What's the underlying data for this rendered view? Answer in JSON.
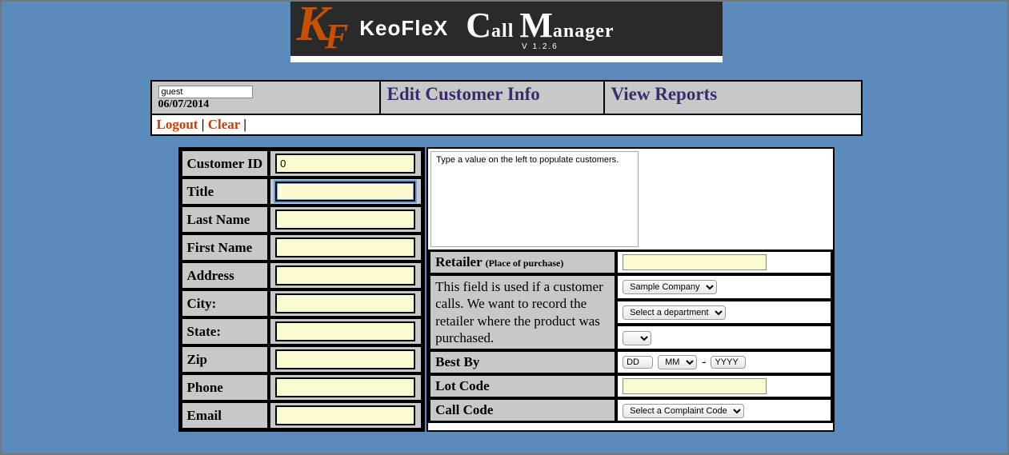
{
  "banner": {
    "brand": "KeoFleX",
    "title_c": "C",
    "title_all": "all ",
    "title_m": "M",
    "title_anager": "anager",
    "version": "V 1.2.6"
  },
  "topbar": {
    "user_value": "guest",
    "date": "06/07/2014",
    "edit_label": "Edit Customer Info",
    "view_label": "View Reports",
    "logout_label": "Logout",
    "clear_label": "Clear",
    "sep": " | "
  },
  "left_labels": {
    "customer_id": "Customer ID",
    "title": "Title",
    "last_name": "Last Name",
    "first_name": "First Name",
    "address": "Address",
    "city": "City:",
    "state": "State:",
    "zip": "Zip",
    "phone": "Phone",
    "email": "Email"
  },
  "left_values": {
    "customer_id": "0",
    "title": "",
    "last_name": "",
    "first_name": "",
    "address": "",
    "city": "",
    "state": "",
    "zip": "",
    "phone": "",
    "email": ""
  },
  "right": {
    "hint": "Type a value on the left to populate customers.",
    "retailer_label": "Retailer",
    "retailer_sub": "(Place of purchase)",
    "retailer_value": "",
    "retailer_note": "This field is used if a customer calls. We want to record the retailer where the product was purchased.",
    "company_options": [
      "Sample Company"
    ],
    "company_value": "Sample Company",
    "dept_options": [
      "Select a department"
    ],
    "dept_value": "Select a department",
    "empty_select_value": "",
    "bestby_label": "Best By",
    "bestby_dd": "DD",
    "bestby_mm": "MM",
    "bestby_sep": "-",
    "bestby_yyyy": "YYYY",
    "lotcode_label": "Lot Code",
    "lotcode_value": "",
    "callcode_label": "Call Code",
    "callcode_options": [
      "Select a Complaint Code"
    ],
    "callcode_value": "Select a Complaint Code"
  }
}
